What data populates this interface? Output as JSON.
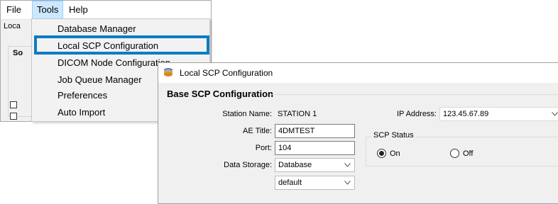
{
  "menubar": {
    "file": "File",
    "tools": "Tools",
    "help": "Help"
  },
  "background": {
    "tab_label": "Loca",
    "group_label": "So"
  },
  "tools_menu": {
    "items": [
      "Database Manager",
      "Local SCP Configuration",
      "DICOM Node Configuration",
      "Job Queue Manager",
      "Preferences",
      "Auto Import"
    ],
    "highlighted": "Local SCP Configuration",
    "highlight_color": "#0e7cc2"
  },
  "dialog": {
    "title": "Local SCP Configuration",
    "title_icon": "app-logo-icon",
    "section_title": "Base SCP Configuration",
    "station_name_label": "Station Name:",
    "station_name_value": "STATION 1",
    "ae_title_label": "AE Title:",
    "ae_title_value": "4DMTEST",
    "port_label": "Port:",
    "port_value": "104",
    "data_storage_label": "Data Storage:",
    "data_storage_value": "Database",
    "data_storage_sub_value": "default",
    "ip_address_label": "IP Address:",
    "ip_address_value": "123.45.67.89",
    "scp_status_title": "SCP Status",
    "status_on_label": "On",
    "status_off_label": "Off",
    "status_selected": "On"
  }
}
